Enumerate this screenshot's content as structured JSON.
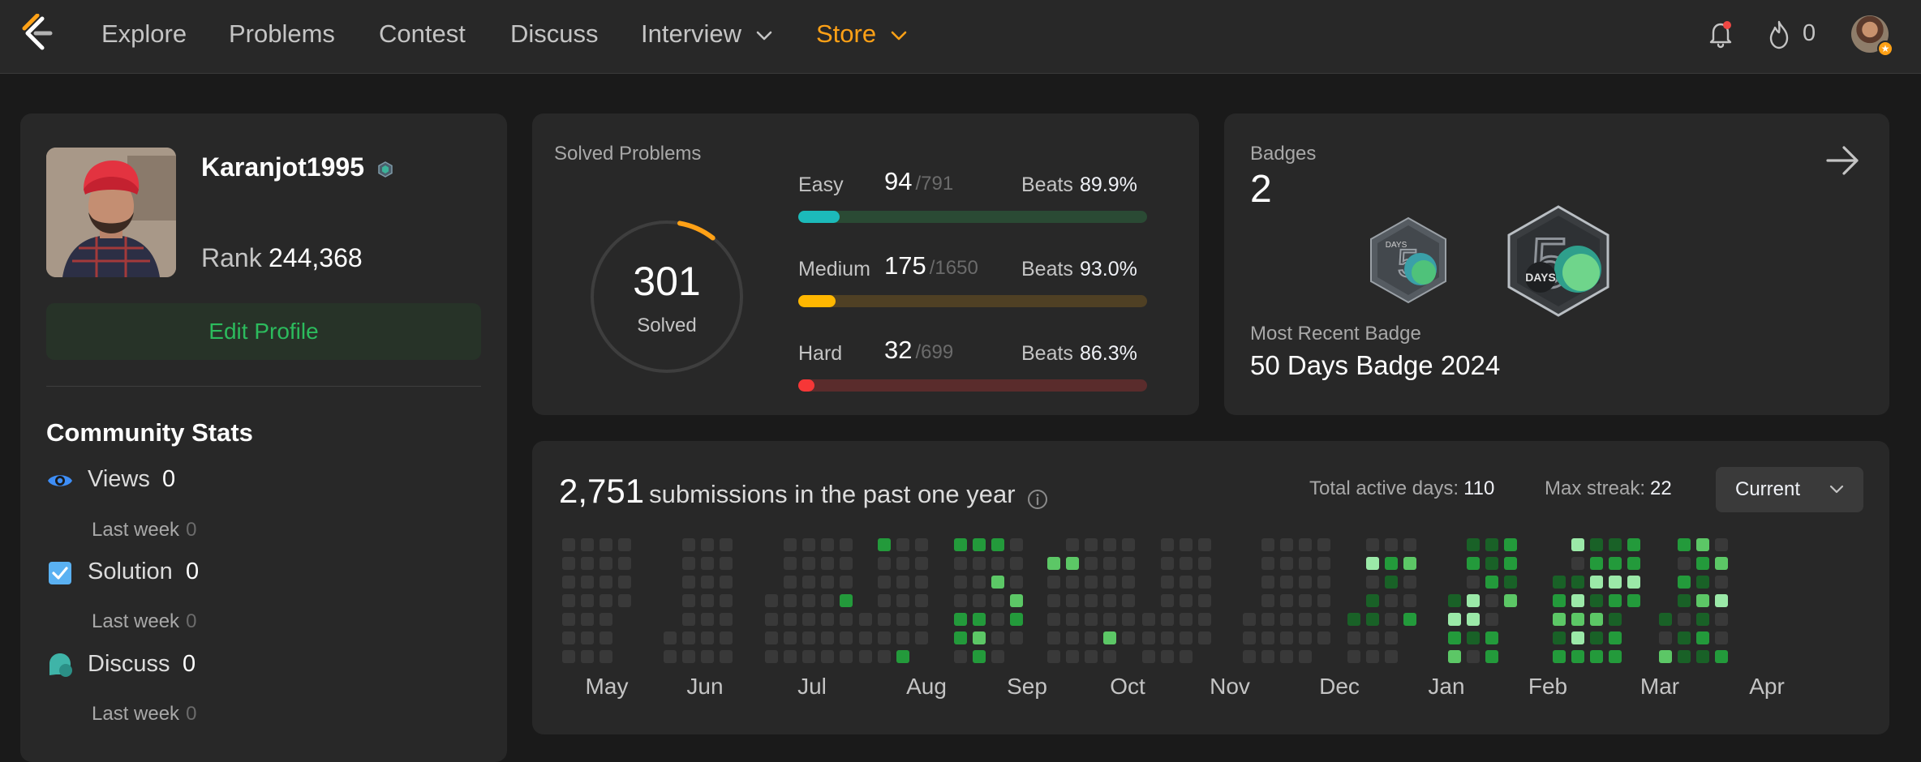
{
  "nav": {
    "items": [
      "Explore",
      "Problems",
      "Contest",
      "Discuss",
      "Interview"
    ],
    "store_label": "Store",
    "streak_count": "0",
    "icons": [
      "leetcode-logo",
      "chevron-down-icon",
      "bell-icon",
      "flame-icon",
      "avatar"
    ],
    "accent": "#ffa116"
  },
  "profile": {
    "username": "Karanjot1995",
    "rank_label": "Rank",
    "rank_value": "244,368",
    "edit_label": "Edit Profile"
  },
  "community": {
    "title": "Community Stats",
    "stats": [
      {
        "icon": "eye-icon",
        "label": "Views",
        "value": "0",
        "sub_label": "Last week",
        "sub_value": "0"
      },
      {
        "icon": "checkbox-icon",
        "label": "Solution",
        "value": "0",
        "sub_label": "Last week",
        "sub_value": "0"
      },
      {
        "icon": "discuss-icon",
        "label": "Discuss",
        "value": "0",
        "sub_label": "Last week",
        "sub_value": "0"
      }
    ]
  },
  "solved": {
    "title": "Solved Problems",
    "total": "301",
    "total_label": "Solved",
    "difficulties": [
      {
        "label": "Easy",
        "solved": "94",
        "total": "/791",
        "beats_label": "Beats",
        "beats": "89.9%",
        "fill_fraction": 0.119,
        "color": "#1cbaba",
        "track": "#2a4a34"
      },
      {
        "label": "Medium",
        "solved": "175",
        "total": "/1650",
        "beats_label": "Beats",
        "beats": "93.0%",
        "fill_fraction": 0.106,
        "color": "#ffb700",
        "track": "#4f4024"
      },
      {
        "label": "Hard",
        "solved": "32",
        "total": "/699",
        "beats_label": "Beats",
        "beats": "86.3%",
        "fill_fraction": 0.046,
        "color": "#f63737",
        "track": "#5a2c2c"
      }
    ]
  },
  "badges": {
    "title": "Badges",
    "count": "2",
    "recent_label": "Most Recent Badge",
    "recent_name": "50 Days Badge 2024",
    "badge_text_small": "DAYS",
    "badge_text_large": "DAYS"
  },
  "submissions": {
    "count": "2,751",
    "text": "submissions in the past one year",
    "active_days_label": "Total active days:",
    "active_days": "110",
    "max_streak_label": "Max streak:",
    "max_streak": "22",
    "range_select": "Current",
    "months": [
      "May",
      "Jun",
      "Jul",
      "Aug",
      "Sep",
      "Oct",
      "Nov",
      "Dec",
      "Jan",
      "Feb",
      "Mar",
      "Apr"
    ],
    "colors": {
      "empty": "#393939",
      "l1": "#196127",
      "l2": "#239a3b",
      "l3": "#5cc766",
      "l4": "#9be9a8"
    }
  }
}
